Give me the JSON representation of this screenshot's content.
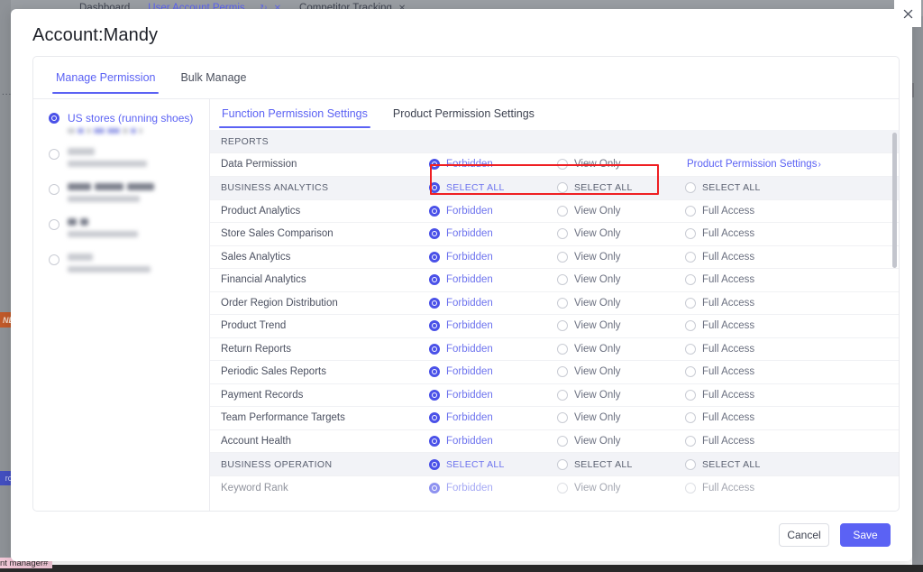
{
  "browser": {
    "tabs": [
      {
        "label": "Dashboard",
        "active": false,
        "has_refresh": false,
        "has_close": false
      },
      {
        "label": "User Account Permis...",
        "active": true,
        "has_refresh": true,
        "has_close": true
      },
      {
        "label": "Competitor Tracking",
        "active": false,
        "has_refresh": false,
        "has_close": true
      }
    ],
    "refresh_glyph": "↻",
    "close_glyph": "✕",
    "background_badges": {
      "new_badge": "NEW",
      "blue_badge": "rch",
      "pink_tag": "nt manager#",
      "dots": "..."
    }
  },
  "window": {
    "close_label": "close"
  },
  "modal": {
    "title": "Account:Mandy",
    "tabs": [
      {
        "label": "Manage Permission",
        "active": true
      },
      {
        "label": "Bulk Manage",
        "active": false
      }
    ]
  },
  "sidebar": {
    "stores": [
      {
        "name": "US stores (running shoes)",
        "selected": true,
        "redacted": false
      },
      {
        "name": "",
        "selected": false,
        "redacted": true
      },
      {
        "name": "",
        "selected": false,
        "redacted": true
      },
      {
        "name": "",
        "selected": false,
        "redacted": true
      },
      {
        "name": "",
        "selected": false,
        "redacted": true
      }
    ]
  },
  "right_pane": {
    "tabs": [
      {
        "label": "Function Permission Settings",
        "active": true
      },
      {
        "label": "Product Permission Settings",
        "active": false
      }
    ]
  },
  "permissions": {
    "select_all_label": "SELECT ALL",
    "options": {
      "forbidden": "Forbidden",
      "view_only": "View Only",
      "full_access": "Full Access"
    },
    "product_settings_link": "Product Permission Settings",
    "link_chevron": "›",
    "sections": [
      {
        "title": "REPORTS",
        "has_select_all": false,
        "rows": [
          {
            "name": "Data Permission",
            "options": [
              {
                "label": "Forbidden",
                "selected": true
              },
              {
                "label": "View Only",
                "selected": false
              }
            ],
            "link": "Product Permission Settings",
            "highlighted": true
          }
        ]
      },
      {
        "title": "BUSINESS ANALYTICS",
        "has_select_all": true,
        "select_all_states": [
          true,
          false,
          false
        ],
        "rows": [
          {
            "name": "Product Analytics",
            "options": [
              {
                "label": "Forbidden",
                "selected": true
              },
              {
                "label": "View Only",
                "selected": false
              },
              {
                "label": "Full Access",
                "selected": false
              }
            ]
          },
          {
            "name": "Store Sales Comparison",
            "options": [
              {
                "label": "Forbidden",
                "selected": true
              },
              {
                "label": "View Only",
                "selected": false
              },
              {
                "label": "Full Access",
                "selected": false
              }
            ]
          },
          {
            "name": "Sales Analytics",
            "options": [
              {
                "label": "Forbidden",
                "selected": true
              },
              {
                "label": "View Only",
                "selected": false
              },
              {
                "label": "Full Access",
                "selected": false
              }
            ]
          },
          {
            "name": "Financial Analytics",
            "options": [
              {
                "label": "Forbidden",
                "selected": true
              },
              {
                "label": "View Only",
                "selected": false
              },
              {
                "label": "Full Access",
                "selected": false
              }
            ]
          },
          {
            "name": "Order Region Distribution",
            "options": [
              {
                "label": "Forbidden",
                "selected": true
              },
              {
                "label": "View Only",
                "selected": false
              },
              {
                "label": "Full Access",
                "selected": false
              }
            ]
          },
          {
            "name": "Product Trend",
            "options": [
              {
                "label": "Forbidden",
                "selected": true
              },
              {
                "label": "View Only",
                "selected": false
              },
              {
                "label": "Full Access",
                "selected": false
              }
            ]
          },
          {
            "name": "Return Reports",
            "options": [
              {
                "label": "Forbidden",
                "selected": true
              },
              {
                "label": "View Only",
                "selected": false
              },
              {
                "label": "Full Access",
                "selected": false
              }
            ]
          },
          {
            "name": "Periodic Sales Reports",
            "options": [
              {
                "label": "Forbidden",
                "selected": true
              },
              {
                "label": "View Only",
                "selected": false
              },
              {
                "label": "Full Access",
                "selected": false
              }
            ]
          },
          {
            "name": "Payment Records",
            "options": [
              {
                "label": "Forbidden",
                "selected": true
              },
              {
                "label": "View Only",
                "selected": false
              },
              {
                "label": "Full Access",
                "selected": false
              }
            ]
          },
          {
            "name": "Team Performance Targets",
            "options": [
              {
                "label": "Forbidden",
                "selected": true
              },
              {
                "label": "View Only",
                "selected": false
              },
              {
                "label": "Full Access",
                "selected": false
              }
            ]
          },
          {
            "name": "Account Health",
            "options": [
              {
                "label": "Forbidden",
                "selected": true
              },
              {
                "label": "View Only",
                "selected": false
              },
              {
                "label": "Full Access",
                "selected": false
              }
            ]
          }
        ]
      },
      {
        "title": "BUSINESS OPERATION",
        "has_select_all": true,
        "select_all_states": [
          true,
          false,
          false
        ],
        "rows": [
          {
            "name": "Keyword Rank",
            "clipped": true,
            "options": [
              {
                "label": "Forbidden",
                "selected": true
              },
              {
                "label": "View Only",
                "selected": false
              },
              {
                "label": "Full Access",
                "selected": false
              }
            ]
          }
        ]
      }
    ]
  },
  "footer": {
    "cancel_label": "Cancel",
    "save_label": "Save"
  },
  "colors": {
    "accent": "#5b62f4",
    "highlight_box": "#ef1f23",
    "group_row_bg": "#f2f3f7"
  }
}
